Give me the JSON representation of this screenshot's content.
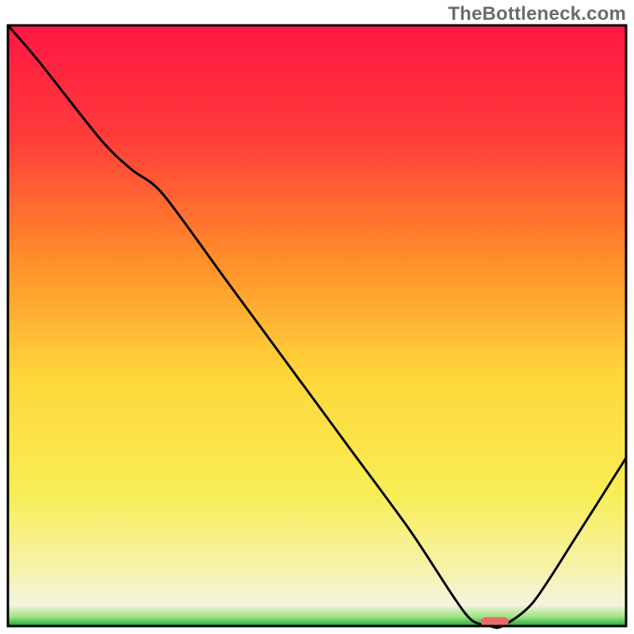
{
  "watermark": "TheBottleneck.com",
  "chart_data": {
    "type": "line",
    "title": "",
    "xlabel": "",
    "ylabel": "",
    "xlim": [
      0,
      100
    ],
    "ylim": [
      0,
      100
    ],
    "grid": false,
    "legend": false,
    "gradient_stops": [
      {
        "pos": 0.0,
        "color": "#ff1744"
      },
      {
        "pos": 0.18,
        "color": "#ff3a3a"
      },
      {
        "pos": 0.38,
        "color": "#ff8a2a"
      },
      {
        "pos": 0.58,
        "color": "#ffd63a"
      },
      {
        "pos": 0.78,
        "color": "#f7ee55"
      },
      {
        "pos": 0.9,
        "color": "#f7f2a8"
      },
      {
        "pos": 0.965,
        "color": "#f4f4e0"
      },
      {
        "pos": 0.985,
        "color": "#9de27d"
      },
      {
        "pos": 1.0,
        "color": "#1aa83a"
      }
    ],
    "series": [
      {
        "name": "bottleneck-curve",
        "x": [
          0,
          5,
          15,
          20,
          25,
          35,
          45,
          55,
          65,
          72,
          75,
          78,
          80,
          85,
          92,
          100
        ],
        "y": [
          100,
          94,
          81,
          76,
          72,
          58,
          44,
          30,
          16,
          5,
          1,
          0,
          0,
          4,
          15,
          28
        ]
      }
    ],
    "marker": {
      "name": "optimal-range",
      "x_start": 76.5,
      "x_end": 81,
      "y": 0.7,
      "color": "#e86a6a"
    }
  }
}
